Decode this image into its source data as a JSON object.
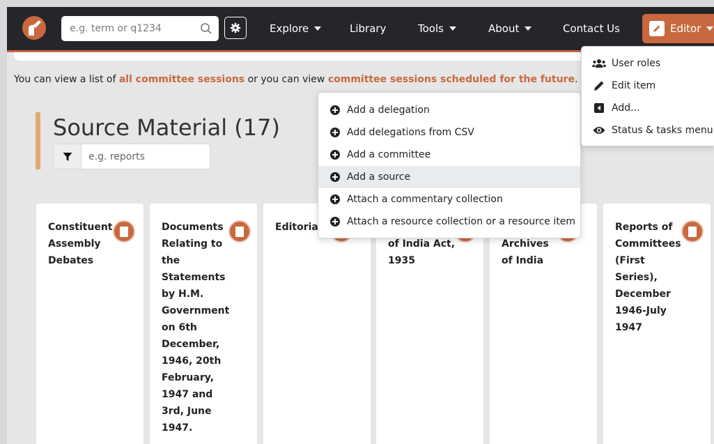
{
  "nav": {
    "search_placeholder": "e.g. term or q1234",
    "items": [
      {
        "label": "Explore",
        "dropdown": true
      },
      {
        "label": "Library",
        "dropdown": false
      },
      {
        "label": "Tools",
        "dropdown": true
      },
      {
        "label": "About",
        "dropdown": true
      },
      {
        "label": "Contact Us",
        "dropdown": false
      }
    ],
    "editor_label": "Editor"
  },
  "editor_menu": {
    "items": [
      {
        "label": "User roles",
        "icon": "users-icon"
      },
      {
        "label": "Edit item",
        "icon": "pencil-icon"
      },
      {
        "label": "Add...",
        "icon": "caret-left-square-icon"
      },
      {
        "label": "Status & tasks menu",
        "icon": "eye-icon"
      }
    ]
  },
  "info": {
    "prefix": "You can view a list of ",
    "link1": "all committee sessions",
    "middle": " or you can view ",
    "link2": "committee sessions scheduled for the future",
    "suffix": "."
  },
  "page_title": "Source Material (17)",
  "filter_placeholder": "e.g. reports",
  "add_menu": {
    "items": [
      {
        "label": "Add a delegation",
        "active": false
      },
      {
        "label": "Add delegations from CSV",
        "active": false
      },
      {
        "label": "Add a committee",
        "active": false
      },
      {
        "label": "Add a source",
        "active": true
      },
      {
        "label": "Attach a commentary collection",
        "active": false
      },
      {
        "label": "Attach a resource collection or a resource item",
        "active": false
      }
    ]
  },
  "cards": [
    {
      "title": "Constituent Assembly Debates",
      "lines": [
        "Constituent",
        "Assembly",
        "Debates"
      ]
    },
    {
      "title": "Documents Relating to the Statements by H.M. Government on 6th December, 1946, 20th February, 1947 and 3rd, June 1947.",
      "lines": [
        "Documents",
        "Relating to",
        "the",
        "Statements",
        "by H.M.",
        "Government",
        "on 6th",
        "December,",
        "1946, 20th",
        "February,",
        "1947 and",
        "3rd, June",
        "1947."
      ]
    },
    {
      "title": "Editorial",
      "lines": [
        "Editorial"
      ]
    },
    {
      "title": "of India Act, 1935",
      "lines": [
        "",
        "of India Act,",
        "1935"
      ]
    },
    {
      "title": "Archives of India",
      "lines": [
        "",
        "Archives",
        "of India"
      ]
    },
    {
      "title": "Reports of Committees (First Series), December 1946-July 1947",
      "lines": [
        "Reports of",
        "Committees",
        "(First",
        "Series),",
        "December",
        "1946-July",
        "1947"
      ]
    }
  ],
  "colors": {
    "accent": "#c9683e",
    "nav_bg": "#25252a",
    "title_bar": "#e0a971"
  }
}
